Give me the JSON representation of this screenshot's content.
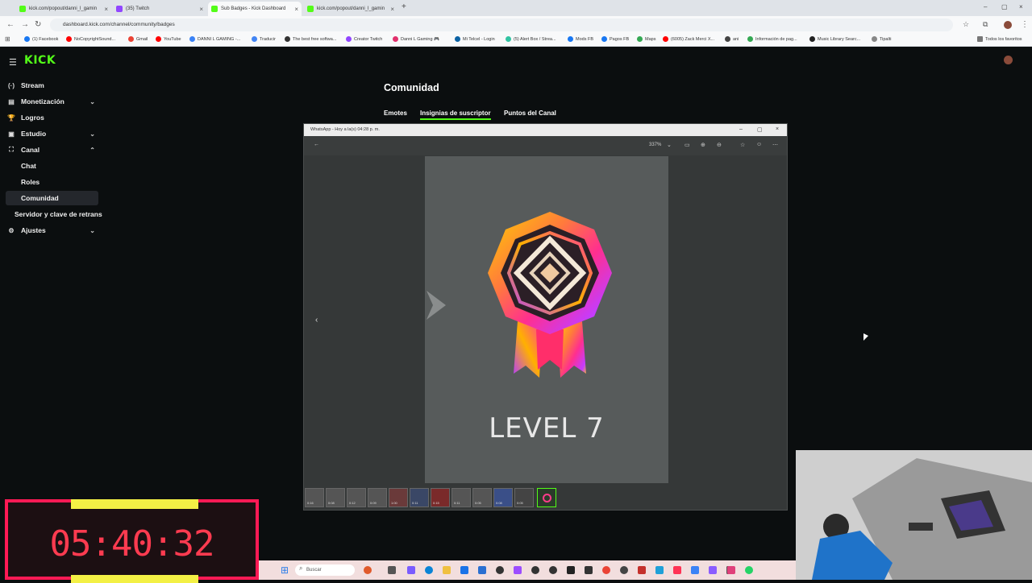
{
  "browser": {
    "tabs": [
      {
        "label": "kick.com/popout/danni_l_gamin",
        "color": "#53fc18"
      },
      {
        "label": "(35) Twitch",
        "color": "#9146ff"
      },
      {
        "label": "Sub Badges - Kick Dashboard",
        "color": "#53fc18"
      },
      {
        "label": "kick.com/popout/danni_l_gamin",
        "color": "#53fc18"
      }
    ],
    "active_tab": 2,
    "url": "dashboard.kick.com/channel/community/badges",
    "bookmarks": [
      {
        "label": "(1) Facebook",
        "color": "#1877f2"
      },
      {
        "label": "NoCopyrightSound...",
        "color": "#ff0000"
      },
      {
        "label": "Gmail",
        "color": "#ea4335"
      },
      {
        "label": "YouTube",
        "color": "#ff0000"
      },
      {
        "label": "DANNI L GAMING -...",
        "color": "#3b82f6"
      },
      {
        "label": "Traducir",
        "color": "#4285f4"
      },
      {
        "label": "The best free softwa...",
        "color": "#333333"
      },
      {
        "label": "Creator Twitch",
        "color": "#9146ff"
      },
      {
        "label": "Danni L Gaming 🎮",
        "color": "#e1306c"
      },
      {
        "label": "Mi Telcel - Login",
        "color": "#0b62a4"
      },
      {
        "label": "(5) Alert Box / Strea...",
        "color": "#31c3a2"
      },
      {
        "label": "Mods FB",
        "color": "#1877f2"
      },
      {
        "label": "Pagos FB",
        "color": "#1877f2"
      },
      {
        "label": "Maps",
        "color": "#34a853"
      },
      {
        "label": "(6005) Zack Merci X...",
        "color": "#ff0000"
      },
      {
        "label": "ani",
        "color": "#444444"
      },
      {
        "label": "Información de pag...",
        "color": "#34a853"
      },
      {
        "label": "Music Library Searc...",
        "color": "#222222"
      },
      {
        "label": "Tipalti",
        "color": "#888888"
      }
    ],
    "all_bookmarks_label": "Todos los favoritos"
  },
  "kick": {
    "logo": "KICK",
    "sidebar": [
      {
        "label": "Stream",
        "icon": "(·)",
        "chevron": ""
      },
      {
        "label": "Monetización",
        "icon": "▤",
        "chevron": "⌄"
      },
      {
        "label": "Logros",
        "icon": "🏆",
        "chevron": ""
      },
      {
        "label": "Estudio",
        "icon": "▣",
        "chevron": "⌄"
      },
      {
        "label": "Canal",
        "icon": "⛶",
        "chevron": "⌃"
      },
      {
        "label": "Chat",
        "icon": "",
        "chevron": ""
      },
      {
        "label": "Roles",
        "icon": "",
        "chevron": ""
      },
      {
        "label": "Comunidad",
        "icon": "",
        "chevron": ""
      },
      {
        "label": "Servidor y clave de retrans",
        "icon": "",
        "chevron": ""
      },
      {
        "label": "Ajustes",
        "icon": "⚙",
        "chevron": "⌄"
      }
    ],
    "page_title": "Comunidad",
    "content_tabs": [
      "Emotes",
      "Insignias de suscriptor",
      "Puntos del Canal"
    ],
    "selected_tab": 1
  },
  "viewer": {
    "title": "WhatsApp - Hoy a la(s) 04:28 p. m.",
    "zoom": "337%",
    "badge_text": "LEVEL 7",
    "thumbnails": [
      "0:16",
      "0:08",
      "0:12",
      "0:09",
      "1:00",
      "0:11",
      "0:15",
      "0:11",
      "0:05",
      "0:08",
      "0:05",
      ""
    ]
  },
  "timer": {
    "value": "05:40:32",
    "color": "#ff3b50"
  },
  "taskbar": {
    "search_placeholder": "Buscar"
  }
}
